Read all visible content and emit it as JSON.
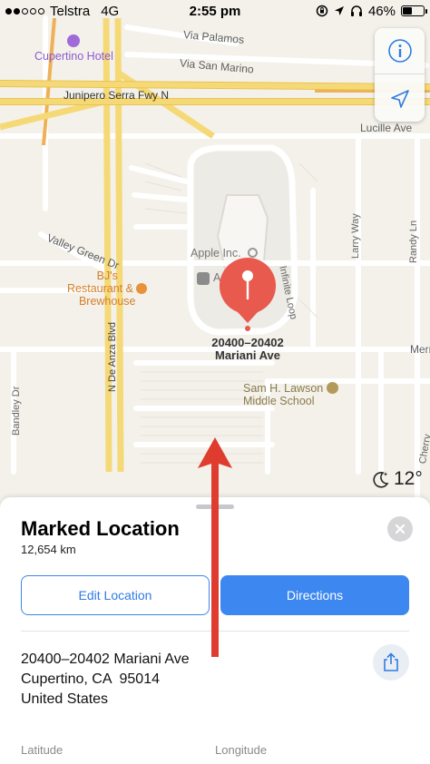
{
  "status_bar": {
    "carrier": "Telstra",
    "network": "4G",
    "time": "2:55 pm",
    "battery": "46%",
    "battery_level": 0.46
  },
  "map": {
    "labels": {
      "hotel": "Cupertino Hotel",
      "via_palamos": "Via Palamos",
      "via_san_marino": "Via San Marino",
      "junipero": "Junipero Serra Fwy N",
      "lucille": "Lucille Ave",
      "valley_green": "Valley Green Dr",
      "apple_inc": "Apple Inc.",
      "apple_partial": "A",
      "infinite_loop": "Infinite Loop",
      "larry_way": "Larry Way",
      "randy_ln": "Randy Ln",
      "restaurant_line1": "BJ's",
      "restaurant_line2": "Restaurant &",
      "restaurant_line3": "Brewhouse",
      "de_anza": "N De Anza Blvd",
      "school_line1": "Sam H. Lawson",
      "school_line2": "Middle School",
      "bandley": "Bandley Dr",
      "merri": "Merri",
      "cherry": "Cherry"
    },
    "pin_address_line1": "20400–20402",
    "pin_address_line2": "Mariani Ave",
    "weather_temp": "12°",
    "weather_icon": "moon-star-icon",
    "controls": {
      "info_icon": "info-icon",
      "location_icon": "location-arrow-icon"
    }
  },
  "sheet": {
    "title": "Marked Location",
    "distance": "12,654 km",
    "edit_button": "Edit Location",
    "directions_button": "Directions",
    "address_line1": "20400–20402 Mariani Ave",
    "address_line2": "Cupertino, CA  95014",
    "address_line3": "United States",
    "latitude_label": "Latitude",
    "longitude_label": "Longitude"
  },
  "colors": {
    "accent": "#3c87f0",
    "pin": "#e8594e",
    "freeway": "#f5d86b",
    "annotation_arrow": "#e03b2f"
  }
}
